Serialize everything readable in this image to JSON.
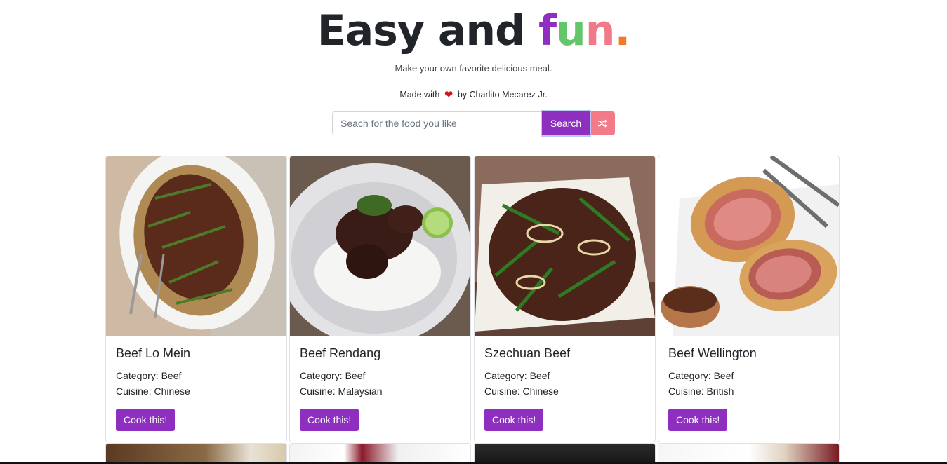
{
  "hero": {
    "title_main": "Easy and ",
    "title_f": "f",
    "title_u": "u",
    "title_n": "n",
    "title_dot": ".",
    "subtitle": "Make your own favorite delicious meal.",
    "credit_prefix": "Made with",
    "credit_suffix": "by Charlito Mecarez Jr."
  },
  "search": {
    "placeholder": "Seach for the food you like",
    "value": "",
    "button_label": "Search",
    "random_icon": "shuffle-icon"
  },
  "colors": {
    "primary": "#8e2fc0",
    "pink": "#f37a88",
    "green": "#63c66a",
    "orange": "#f07a2a"
  },
  "meals": [
    {
      "name": "Beef Lo Mein",
      "category": "Category: Beef",
      "cuisine": "Cuisine: Chinese",
      "button": "Cook this!"
    },
    {
      "name": "Beef Rendang",
      "category": "Category: Beef",
      "cuisine": "Cuisine: Malaysian",
      "button": "Cook this!"
    },
    {
      "name": "Szechuan Beef",
      "category": "Category: Beef",
      "cuisine": "Cuisine: Chinese",
      "button": "Cook this!"
    },
    {
      "name": "Beef Wellington",
      "category": "Category: Beef",
      "cuisine": "Cuisine: British",
      "button": "Cook this!"
    }
  ]
}
